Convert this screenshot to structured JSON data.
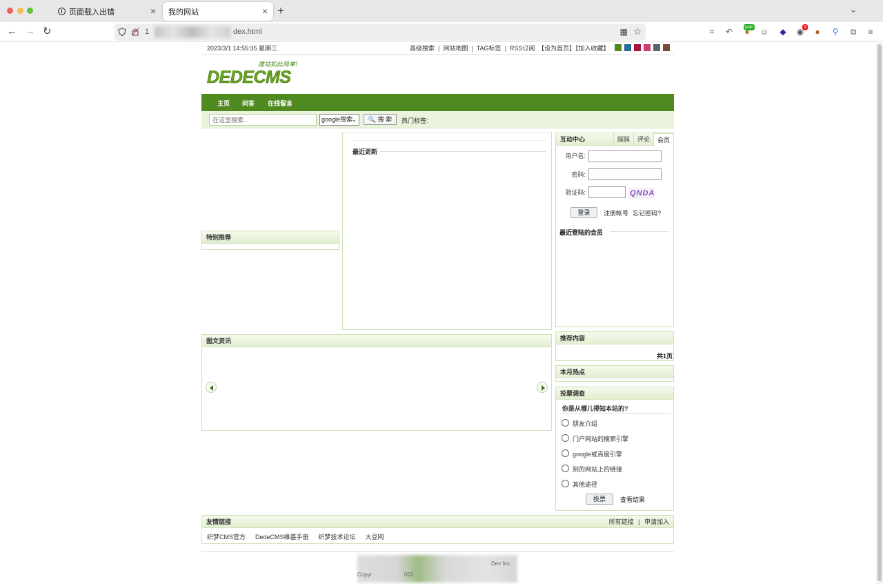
{
  "browser": {
    "tabs": [
      {
        "title": "页面载入出错",
        "active": false
      },
      {
        "title": "我的网站",
        "active": true
      }
    ],
    "url": "1",
    "url_suffix": "dex.html"
  },
  "topbar": {
    "datetime": "2023/3/1 14:55:35 星期三",
    "links": [
      "高级搜索",
      "网站地图",
      "TAG标签",
      "RSS订阅"
    ],
    "set_home": "【设为首页】",
    "add_fav": "【加入收藏】",
    "style_swatches": [
      "#4f8a20",
      "#2a6b9c",
      "#a8143c",
      "#d23b6f",
      "#5a646c",
      "#7b4a3a"
    ]
  },
  "logo": {
    "slogan": "建站如此简单!",
    "name": "DEDECMS"
  },
  "nav": {
    "items": [
      "主页",
      "问答",
      "在线留言"
    ]
  },
  "search": {
    "placeholder": "在这里搜索...",
    "engine": "google搜索",
    "button": "搜 索",
    "hot_label": "热门标签:"
  },
  "special": {
    "title": "特别推荐"
  },
  "latest": {
    "title": "最近更新"
  },
  "picnews": {
    "title": "图文资讯"
  },
  "member": {
    "title": "互动中心",
    "tabs": [
      "踩踩",
      "评论",
      "会员"
    ],
    "username_label": "用户名:",
    "password_label": "密码:",
    "captcha_label": "验证码:",
    "captcha_text": "QNDA",
    "login_button": "登录",
    "register_link": "注册帐号",
    "forgot_link": "忘记密码?",
    "recent_members": "最近登陆的会员"
  },
  "recommend": {
    "title": "推荐内容",
    "page_count": "共1页"
  },
  "monthly_hot": {
    "title": "本月热点"
  },
  "vote": {
    "title": "投票调查",
    "question": "你是从哪儿得知本站的?",
    "options": [
      "朋友介绍",
      "门户网站的搜索引擎",
      "google或百度引擎",
      "别的网站上的链接",
      "其他途径"
    ],
    "submit": "投票",
    "results": "查看结果"
  },
  "friend_links": {
    "title": "友情链接",
    "all_links": "所有链接",
    "apply": "申请加入",
    "items": [
      "织梦CMS官方",
      "DedeCMS维基手册",
      "织梦技术论坛",
      "大豆网"
    ]
  },
  "footer": {
    "left": "Copyr",
    "year": "002",
    "right": "Dev Inc."
  }
}
